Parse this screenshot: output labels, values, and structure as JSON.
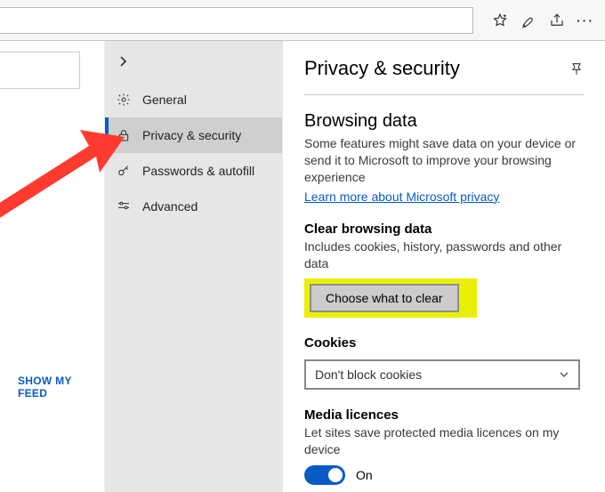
{
  "topbar": {
    "icons": [
      "favorites-icon",
      "reading-list-icon",
      "share-icon",
      "more-icon"
    ]
  },
  "left": {
    "show_feed": "SHOW MY FEED"
  },
  "sidebar": {
    "items": [
      {
        "label": "General",
        "icon": "gear-icon"
      },
      {
        "label": "Privacy & security",
        "icon": "lock-icon",
        "selected": true
      },
      {
        "label": "Passwords & autofill",
        "icon": "key-icon"
      },
      {
        "label": "Advanced",
        "icon": "sliders-icon"
      }
    ]
  },
  "detail": {
    "title": "Privacy & security",
    "browsing_data": {
      "heading": "Browsing data",
      "desc": "Some features might save data on your device or send it to Microsoft to improve your browsing experience",
      "link": "Learn more about Microsoft privacy"
    },
    "clear": {
      "heading": "Clear browsing data",
      "desc": "Includes cookies, history, passwords and other data",
      "button": "Choose what to clear"
    },
    "cookies": {
      "heading": "Cookies",
      "selected": "Don't block cookies"
    },
    "media": {
      "heading": "Media licences",
      "desc": "Let sites save protected media licences on my device",
      "toggle_label": "On"
    }
  }
}
